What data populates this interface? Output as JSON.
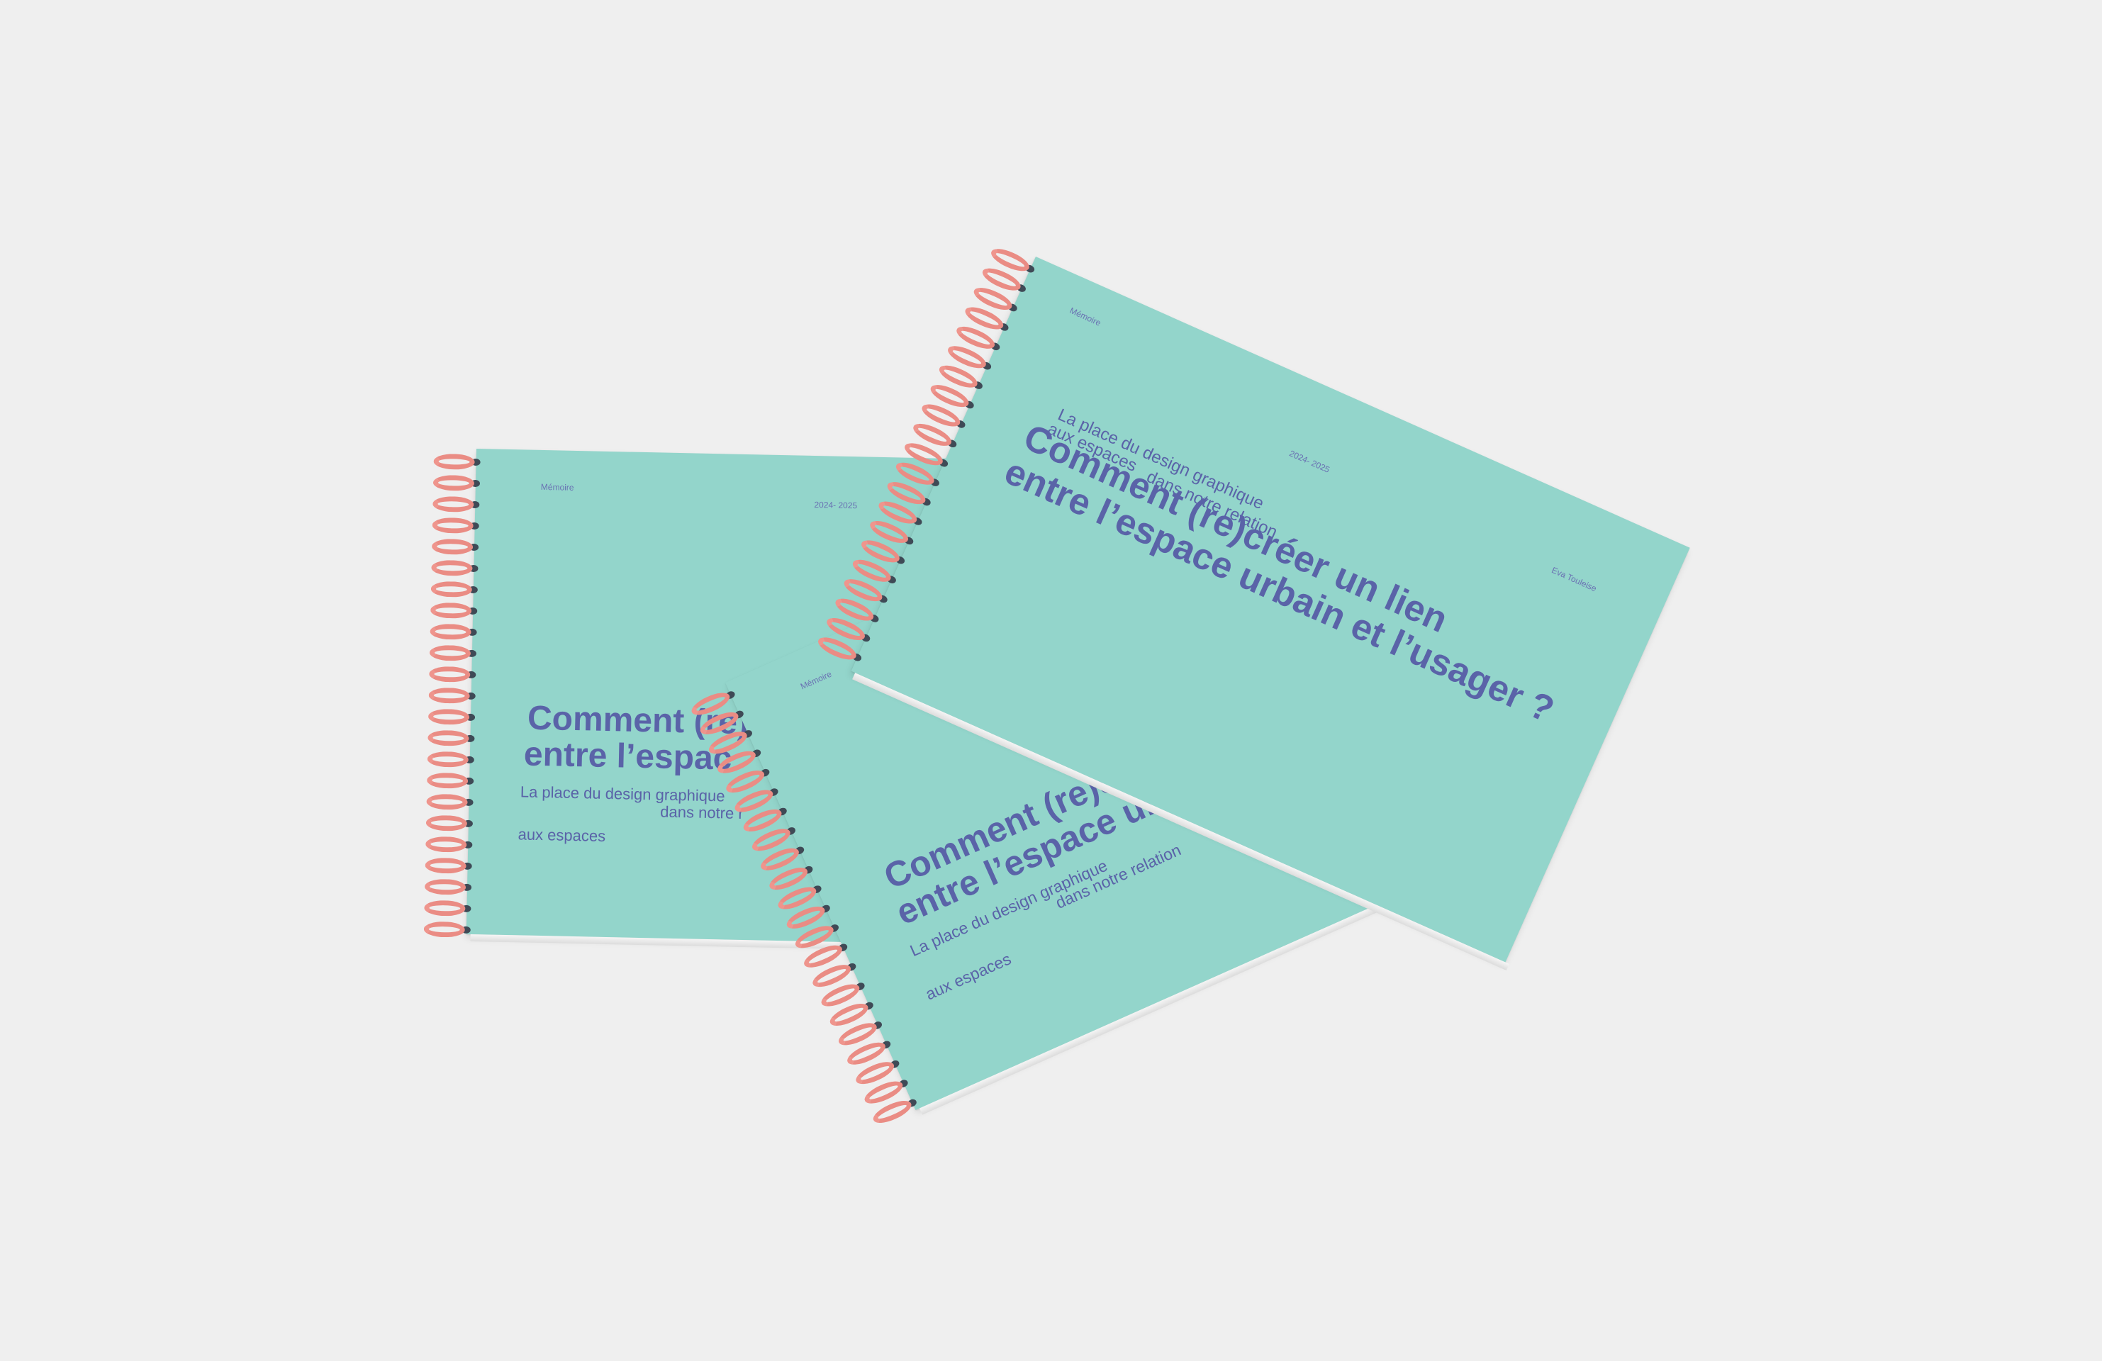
{
  "colors": {
    "background": "#efefef",
    "cover": "#93d5cb",
    "text": "#5a63a8",
    "spiral": "#ea8c84"
  },
  "book_left": {
    "label": "Mémoire",
    "year": "2024- 2025",
    "title_line1": "Comment (re)c",
    "title_line2": "entre l’espac",
    "sub_line1": "La place du design graphique",
    "sub_line2": "dans notre r",
    "sub_line3": "aux espaces"
  },
  "book_bottom": {
    "label": "Mémoire",
    "title_line1": "Comment (re)cr",
    "title_line2": "entre l’espace urb",
    "sub_line1": "La place du design graphique",
    "sub_line2": "dans notre relation",
    "sub_line3": "aux espaces"
  },
  "book_top": {
    "label": "Mémoire",
    "year": "2024- 2025",
    "author": "Eva Touleise",
    "title_line1": "Comment (re)créer un lien",
    "title_line2": "entre l’espace urbain et l’usager ?",
    "sub_line1": "La place du design graphique",
    "sub_line2": "dans notre relation",
    "sub_line3": "aux espaces"
  }
}
